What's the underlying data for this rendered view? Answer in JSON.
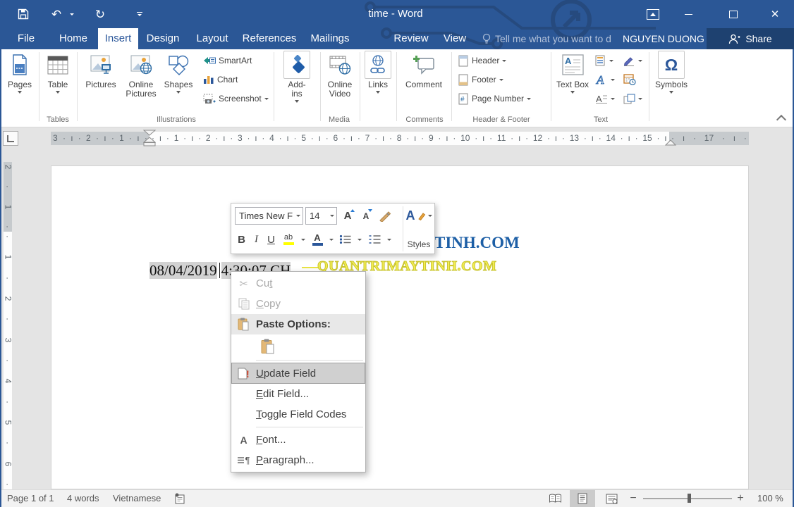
{
  "window": {
    "title": "time - Word"
  },
  "icons": {
    "undo": "↶",
    "redo": "↻",
    "close": "✕",
    "omega": "Ω",
    "scissors": "✂",
    "pilcrow": "¶",
    "letter_a": "A",
    "exclamation": "!",
    "minus": "−",
    "plus": "+",
    "hash": "#"
  },
  "tabs": {
    "file": "File",
    "home": "Home",
    "insert": "Insert",
    "design": "Design",
    "layout": "Layout",
    "references": "References",
    "mailings": "Mailings",
    "review": "Review",
    "view": "View"
  },
  "tell_me": {
    "text": "Tell me what you want to d"
  },
  "account": {
    "name": "NGUYEN DUONG"
  },
  "share": {
    "label": "Share"
  },
  "ribbon": {
    "pages": {
      "label": "Pages"
    },
    "tables": {
      "group": "Tables",
      "table": "Table"
    },
    "illustrations": {
      "group": "Illustrations",
      "pictures": "Pictures",
      "online_pictures": "Online Pictures",
      "shapes": "Shapes",
      "smartart": "SmartArt",
      "chart": "Chart",
      "screenshot": "Screenshot"
    },
    "addins": {
      "label": "Add-ins"
    },
    "media": {
      "group": "Media",
      "online_video": "Online Video"
    },
    "links": {
      "label": "Links"
    },
    "comments": {
      "group": "Comments",
      "comment": "Comment"
    },
    "header_footer": {
      "group": "Header & Footer",
      "header": "Header",
      "footer": "Footer",
      "page_number": "Page Number"
    },
    "text": {
      "group": "Text",
      "text_box": "Text Box"
    },
    "symbols": {
      "label": "Symbols"
    }
  },
  "ruler": {
    "h_left": [
      "3",
      "·",
      "ı",
      "·",
      "2",
      "·",
      "ı",
      "·",
      "1",
      "·",
      "ı",
      "·"
    ],
    "h_main": [
      "·",
      "ı",
      "·",
      "1",
      "·",
      "ı",
      "·",
      "2",
      "·",
      "ı",
      "·",
      "3",
      "·",
      "ı",
      "·",
      "4",
      "·",
      "ı",
      "·",
      "5",
      "·",
      "ı",
      "·",
      "6",
      "·",
      "ı",
      "·",
      "7",
      "·",
      "ı",
      "·",
      "8",
      "·",
      "ı",
      "·",
      "9",
      "·",
      "ı",
      "·",
      "10",
      "·",
      "ı",
      "·",
      "11",
      "·",
      "ı",
      "·",
      "12",
      "·",
      "ı",
      "·",
      "13",
      "·",
      "ı",
      "·",
      "14",
      "·",
      "ı",
      "·",
      "15",
      "·",
      "ı"
    ],
    "h_right": [
      "·",
      "ı",
      "·",
      "17",
      "·",
      "ı",
      "·"
    ],
    "v_top": [
      "2",
      "·",
      "1",
      "·"
    ],
    "v_main": [
      "·",
      "1",
      "·",
      "2",
      "·",
      "3",
      "·",
      "4",
      "·",
      "5",
      "·",
      "6",
      "·"
    ]
  },
  "document": {
    "date": "08/04/2019",
    "time": "4:30:07 CH",
    "watermark_blue": "TINH.COM",
    "watermark_yellow": "QUANTRIMAYTINH.COM"
  },
  "mini_toolbar": {
    "font_name": "Times New F",
    "font_size": "14",
    "grow": "A",
    "shrink": "A",
    "bold": "B",
    "italic": "I",
    "underline": "U",
    "highlight": "ab",
    "font_color": "A",
    "styles_label": "Styles"
  },
  "context_menu": {
    "cut": "Cu&t",
    "copy": "&Copy",
    "paste_options": "Paste Options:",
    "update_field": "&Update Field",
    "edit_field": "&Edit Field...",
    "toggle_field_codes": "&Toggle Field Codes",
    "font": "&Font...",
    "paragraph": "&Paragraph..."
  },
  "status_bar": {
    "page": "Page 1 of 1",
    "words": "4 words",
    "language": "Vietnamese",
    "zoom_level": "100 %"
  },
  "colors": {
    "titlebar": "#2b5796",
    "accent": "#2b579a",
    "share_bg": "#1e4170",
    "selection": "#d2d2d2",
    "watermark_blue": "#1d5fa6",
    "watermark_yellow": "#f3ee55",
    "highlight_yellow": "#ffff00",
    "selected_menu_item": "#d0d0d0"
  }
}
